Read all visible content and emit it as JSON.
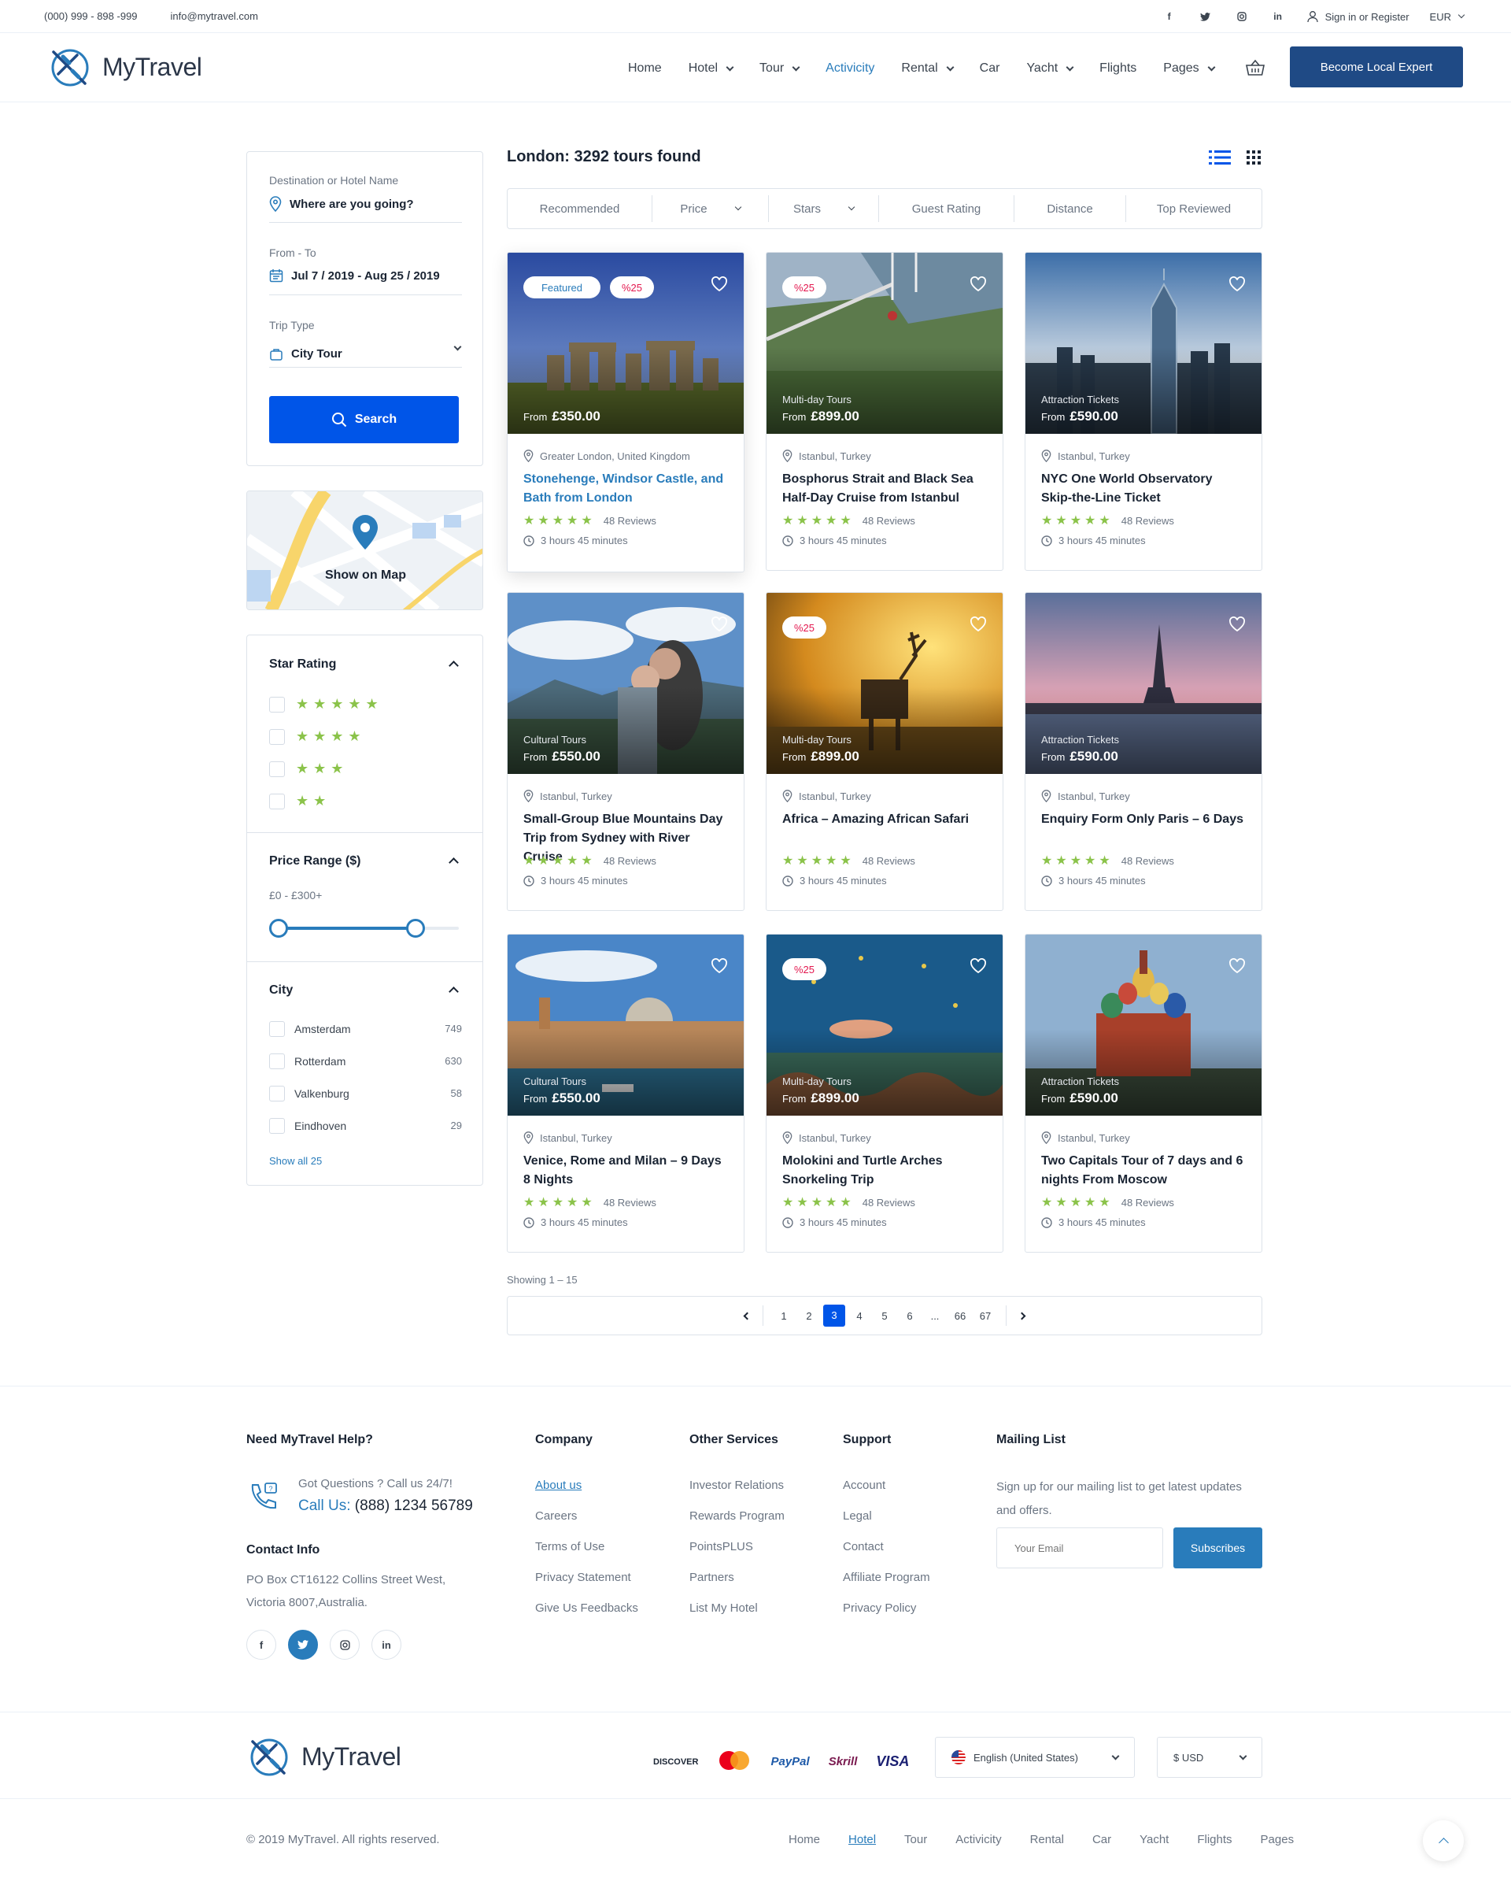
{
  "topbar": {
    "phone": "(000) 999 - 898 -999",
    "email": "info@mytravel.com",
    "signin": "Sign in or Register",
    "currency": "EUR",
    "social": [
      "f",
      "t",
      "ig",
      "in"
    ]
  },
  "header": {
    "logo": "MyTravel",
    "nav": [
      {
        "label": "Home",
        "dd": false
      },
      {
        "label": "Hotel",
        "dd": true
      },
      {
        "label": "Tour",
        "dd": true
      },
      {
        "label": "Activicity",
        "dd": false,
        "active": true
      },
      {
        "label": "Rental",
        "dd": true
      },
      {
        "label": "Car",
        "dd": false
      },
      {
        "label": "Yacht",
        "dd": true
      },
      {
        "label": "Flights",
        "dd": false
      },
      {
        "label": "Pages",
        "dd": true
      }
    ],
    "cta": "Become Local Expert"
  },
  "search": {
    "dest_label": "Destination or Hotel Name",
    "dest_value": "Where are you going?",
    "date_label": "From - To",
    "date_value": "Jul 7 / 2019 - Aug 25 / 2019",
    "trip_label": "Trip Type",
    "trip_value": "City Tour",
    "button": "Search"
  },
  "map": {
    "label": "Show on Map"
  },
  "filters": {
    "star_title": "Star Rating",
    "star_rows": [
      5,
      4,
      3,
      2
    ],
    "price_title": "Price Range ($)",
    "price_range": "£0 - £300+",
    "price_min_fraction": 0.05,
    "price_max_fraction": 0.77,
    "city_title": "City",
    "cities": [
      {
        "name": "Amsterdam",
        "count": "749"
      },
      {
        "name": "Rotterdam",
        "count": "630"
      },
      {
        "name": "Valkenburg",
        "count": "58"
      },
      {
        "name": "Eindhoven",
        "count": "29"
      }
    ],
    "show_all": "Show all 25"
  },
  "results": {
    "heading": "London: 3292 tours found",
    "sort_tabs": [
      {
        "label": "Recommended",
        "dd": false
      },
      {
        "label": "Price",
        "dd": true
      },
      {
        "label": "Stars",
        "dd": true
      },
      {
        "label": "Guest Rating",
        "dd": false
      },
      {
        "label": "Distance",
        "dd": false
      },
      {
        "label": "Top Reviewed",
        "dd": false
      }
    ],
    "tours": [
      {
        "featured": "Featured",
        "discount": "%25",
        "category": "",
        "price_prefix": "From",
        "price": "£350.00",
        "location": "Greater London, United Kingdom",
        "title": "Stonehenge, Windsor Castle, and Bath from London",
        "reviews": "48 Reviews",
        "duration": "3 hours 45 minutes",
        "scene": "stone",
        "highlight": true
      },
      {
        "featured": "",
        "discount": "%25",
        "category": "Multi-day Tours",
        "price_prefix": "From",
        "price": "£899.00",
        "location": "Istanbul, Turkey",
        "title": "Bosphorus Strait and Black Sea Half-Day Cruise from Istanbul",
        "reviews": "48 Reviews",
        "duration": "3 hours 45 minutes",
        "scene": "bridge",
        "highlight": false
      },
      {
        "featured": "",
        "discount": "",
        "category": "Attraction Tickets",
        "price_prefix": "From",
        "price": "£590.00",
        "location": "Istanbul, Turkey",
        "title": "NYC One World Observatory Skip-the-Line Ticket",
        "reviews": "48 Reviews",
        "duration": "3 hours 45 minutes",
        "scene": "tower",
        "highlight": false
      },
      {
        "featured": "",
        "discount": "",
        "category": "Cultural Tours",
        "price_prefix": "From",
        "price": "£550.00",
        "location": "Istanbul, Turkey",
        "title": "Small-Group Blue Mountains Day Trip from Sydney with River Cruise",
        "reviews": "48 Reviews",
        "duration": "3 hours 45 minutes",
        "scene": "mountain",
        "highlight": false
      },
      {
        "featured": "",
        "discount": "%25",
        "category": "Multi-day Tours",
        "price_prefix": "From",
        "price": "£899.00",
        "location": "Istanbul, Turkey",
        "title": "Africa – Amazing African Safari",
        "reviews": "48 Reviews",
        "duration": "3 hours 45 minutes",
        "scene": "deer",
        "highlight": false
      },
      {
        "featured": "",
        "discount": "",
        "category": "Attraction Tickets",
        "price_prefix": "From",
        "price": "£590.00",
        "location": "Istanbul, Turkey",
        "title": "Enquiry Form Only Paris – 6 Days",
        "reviews": "48 Reviews",
        "duration": "3 hours 45 minutes",
        "scene": "paris",
        "highlight": false
      },
      {
        "featured": "",
        "discount": "",
        "category": "Cultural Tours",
        "price_prefix": "From",
        "price": "£550.00",
        "location": "Istanbul, Turkey",
        "title": "Venice, Rome and Milan – 9 Days 8 Nights",
        "reviews": "48 Reviews",
        "duration": "3 hours 45 minutes",
        "scene": "venice",
        "highlight": false
      },
      {
        "featured": "",
        "discount": "%25",
        "category": "Multi-day Tours",
        "price_prefix": "From",
        "price": "£899.00",
        "location": "Istanbul, Turkey",
        "title": "Molokini and Turtle Arches Snorkeling Trip",
        "reviews": "48 Reviews",
        "duration": "3 hours 45 minutes",
        "scene": "sea",
        "highlight": false
      },
      {
        "featured": "",
        "discount": "",
        "category": "Attraction Tickets",
        "price_prefix": "From",
        "price": "£590.00",
        "location": "Istanbul, Turkey",
        "title": "Two Capitals Tour of 7 days and 6 nights From Moscow",
        "reviews": "48 Reviews",
        "duration": "3 hours 45 minutes",
        "scene": "moscow",
        "highlight": false
      }
    ],
    "showing": "Showing 1 – 15",
    "pages": [
      "1",
      "2",
      "3",
      "4",
      "5",
      "6",
      "...",
      "66",
      "67"
    ],
    "current_page": "3"
  },
  "footer": {
    "help_title": "Need MyTravel Help?",
    "help_q": "Got Questions ? Call us 24/7!",
    "call_label": "Call Us:",
    "call_number": "(888) 1234 56789",
    "contact_title": "Contact Info",
    "address1": "PO Box CT16122 Collins Street West,",
    "address2": "Victoria 8007,Australia.",
    "cols": [
      {
        "title": "Company",
        "links": [
          "About us",
          "Careers",
          "Terms of Use",
          "Privacy Statement",
          "Give Us Feedbacks"
        ]
      },
      {
        "title": "Other Services",
        "links": [
          "Investor Relations",
          "Rewards Program",
          "PointsPLUS",
          "Partners",
          "List My Hotel"
        ]
      },
      {
        "title": "Support",
        "links": [
          "Account",
          "Legal",
          "Contact",
          "Affiliate Program",
          "Privacy Policy"
        ]
      }
    ],
    "mail_title": "Mailing List",
    "mail_text1": "Sign up for our mailing list to get latest updates",
    "mail_text2": "and offers.",
    "mail_placeholder": "Your Email",
    "mail_button": "Subscribes",
    "logo": "MyTravel",
    "payments": [
      "DISCOVER",
      "mc",
      "PayPal",
      "Skrill",
      "VISA"
    ],
    "language": "English (United States)",
    "currency": "$ USD",
    "copyright": "© 2019 MyTravel. All rights reserved.",
    "bottom_nav": [
      "Home",
      "Hotel",
      "Tour",
      "Activicity",
      "Rental",
      "Car",
      "Yacht",
      "Flights",
      "Pages"
    ]
  },
  "colors": {
    "primary": "#0055e8",
    "navy": "#1f4a85",
    "link": "#297cbb",
    "star": "#8bc34a",
    "discount": "#e3174e"
  }
}
